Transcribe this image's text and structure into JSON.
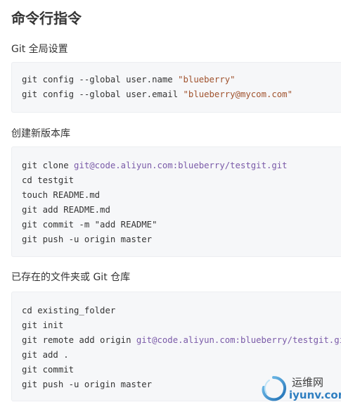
{
  "page_title": "命令行指令",
  "sections": [
    {
      "heading": "Git 全局设置",
      "lines": [
        {
          "plain": "git config --global user.name ",
          "str": "\"blueberry\""
        },
        {
          "plain": "git config --global user.email ",
          "str": "\"blueberry@mycom.com\""
        }
      ]
    },
    {
      "heading": "创建新版本库",
      "lines": [
        {
          "plain": "git clone ",
          "str2": "git@code.aliyun.com:blueberry/testgit.git"
        },
        {
          "plain": "cd testgit"
        },
        {
          "plain": "touch README.md"
        },
        {
          "plain": "git add README.md"
        },
        {
          "plain": "git commit -m \"add README\""
        },
        {
          "plain": "git push -u origin master"
        }
      ]
    },
    {
      "heading": "已存在的文件夹或 Git 仓库",
      "lines": [
        {
          "plain": "cd existing_folder"
        },
        {
          "plain": "git init"
        },
        {
          "plain": "git remote add origin ",
          "str2": "git@code.aliyun.com:blueberry/testgit.git"
        },
        {
          "plain": "git add ."
        },
        {
          "plain": "git commit"
        },
        {
          "plain": "git push -u origin master"
        }
      ]
    }
  ],
  "watermark": {
    "cn": "运维网",
    "en": "iyunv.com"
  },
  "colors": {
    "string_token": "#a0522d",
    "url_token": "#7a5aa8",
    "code_bg": "#f6f7f9"
  }
}
